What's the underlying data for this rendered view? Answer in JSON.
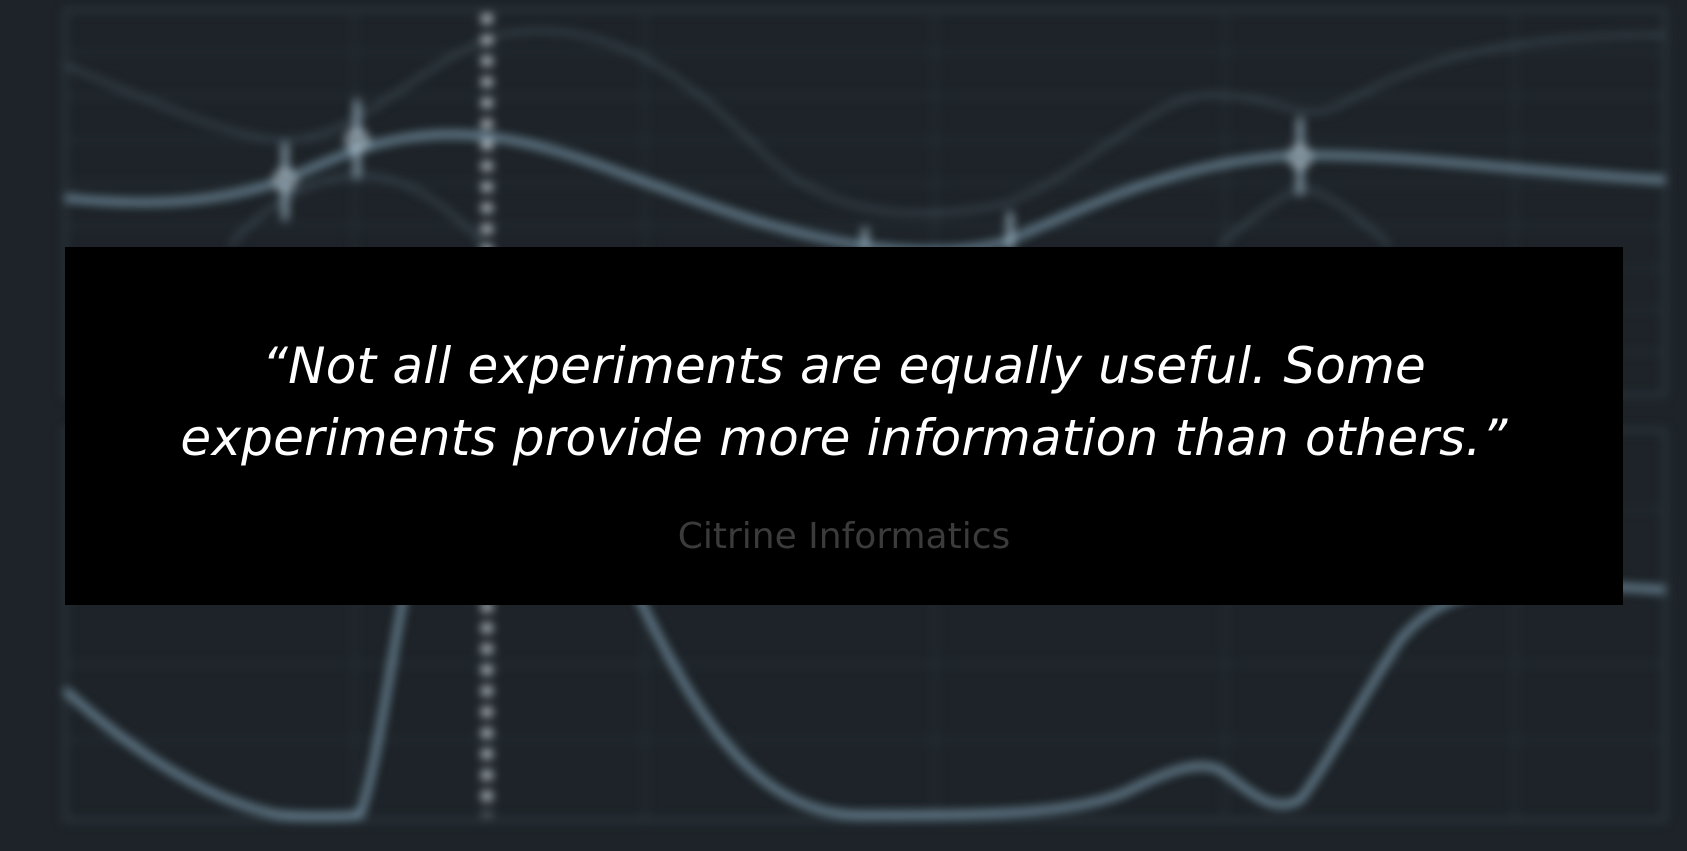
{
  "quote": {
    "text": "“Not all experiments are equally useful. Some experiments provide more information than others.”",
    "author": "Citrine Informatics"
  },
  "colors": {
    "background": "#1d2328",
    "grid": "#2f3a42",
    "curve": "#8fb3c9",
    "curve_faint": "#4a5a66",
    "quote_box": "#000000",
    "quote_text": "#ffffff",
    "author_text": "#3b3b3b"
  }
}
